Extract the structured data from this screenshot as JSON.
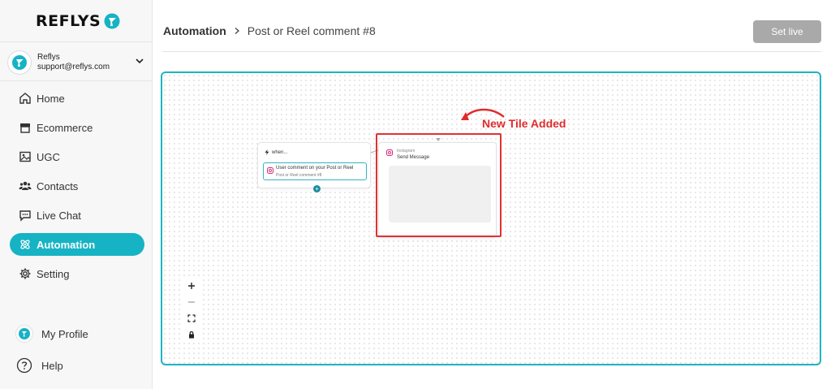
{
  "brand": {
    "name": "REFLYS",
    "accent": "#16b3c4"
  },
  "account": {
    "name": "Reflys",
    "email": "support@reflys.com"
  },
  "nav": {
    "items": [
      {
        "label": "Home",
        "icon": "home-icon"
      },
      {
        "label": "Ecommerce",
        "icon": "store-icon"
      },
      {
        "label": "UGC",
        "icon": "image-icon"
      },
      {
        "label": "Contacts",
        "icon": "users-icon"
      },
      {
        "label": "Live Chat",
        "icon": "chat-icon"
      },
      {
        "label": "Automation",
        "icon": "atom-icon",
        "active": true
      },
      {
        "label": "Setting",
        "icon": "gear-icon"
      }
    ],
    "bottom": [
      {
        "label": "My Profile",
        "icon": "profile-icon"
      },
      {
        "label": "Help",
        "icon": "help-icon"
      }
    ]
  },
  "header": {
    "breadcrumb_root": "Automation",
    "breadcrumb_leaf": "Post or Reel comment #8",
    "set_live_label": "Set live"
  },
  "canvas": {
    "when_node": {
      "title": "when...",
      "trigger_title": "User comment on your Post or Reel",
      "trigger_subtitle": "Post or Reel comment #8"
    },
    "send_node": {
      "platform": "Instagram",
      "title": "Send Message"
    },
    "annotation": "New Tile Added",
    "annotation_color": "#e02b2b",
    "zoom_controls": [
      "+",
      "—",
      "fit",
      "lock"
    ]
  }
}
